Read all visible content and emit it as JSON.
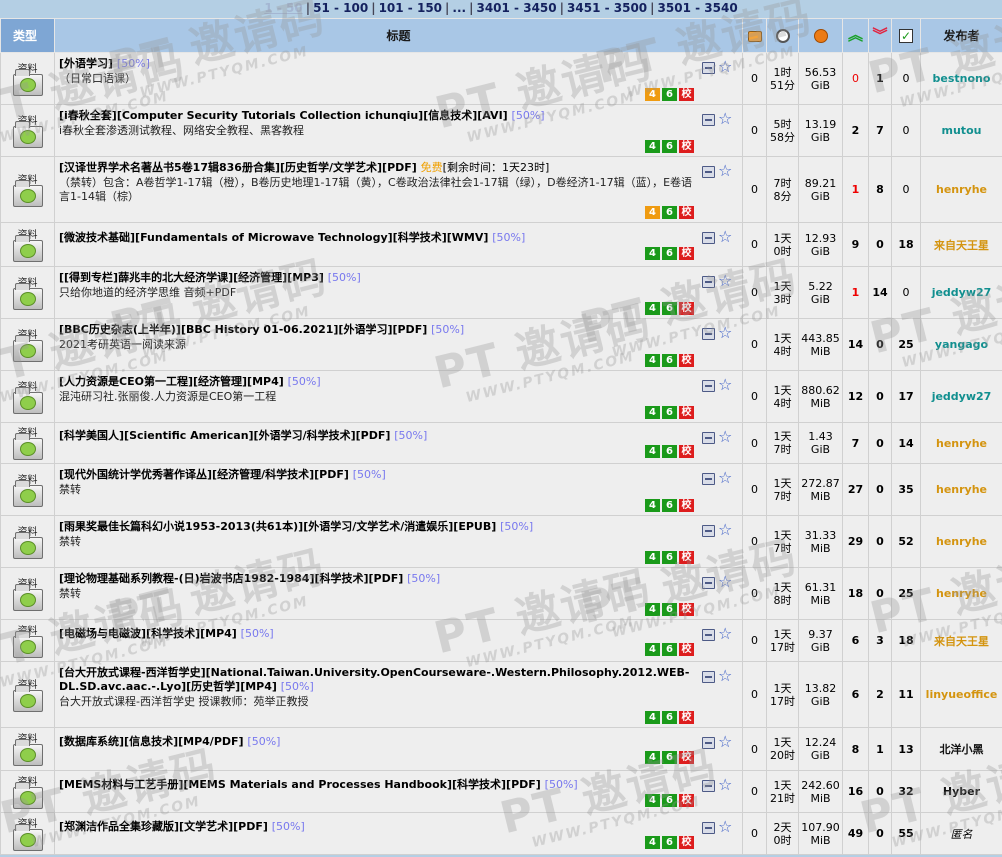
{
  "pager": {
    "items": [
      "1 - 50",
      "51 - 100",
      "101 - 150",
      "...",
      "3401 - 3450",
      "3451 - 3500",
      "3501 - 3540"
    ],
    "current_index": 0,
    "separator": "|"
  },
  "header": {
    "type": "类型",
    "title": "标题",
    "uploader": "发布者",
    "icons": [
      "comments-icon",
      "time-icon",
      "size-icon",
      "seeders-icon",
      "leechers-icon",
      "completed-icon"
    ]
  },
  "watermark": {
    "big": "PT 邀请码",
    "small": "WWW.PTYQM.COM"
  },
  "torrents": [
    {
      "category": "资料",
      "title": "[外语学习]",
      "pct": "[50%]",
      "sub": "（日常口语课）",
      "free": "",
      "remain": "",
      "badge4": "orange",
      "comments": "0",
      "time": [
        "1时",
        "51分"
      ],
      "size": [
        "56.53",
        "GiB"
      ],
      "seeders": "0",
      "leechers": "1",
      "completed": "0",
      "uploader": "bestnono",
      "uploader_color": "teal"
    },
    {
      "category": "资料",
      "title": "[i春秋全套][Computer Security Tutorials Collection ichunqiu][信息技术][AVI]",
      "pct": "[50%]",
      "sub": "i春秋全套渗透测试教程、网络安全教程、黑客教程",
      "free": "",
      "remain": "",
      "badge4": "green",
      "comments": "0",
      "time": [
        "5时",
        "58分"
      ],
      "size": [
        "13.19",
        "GiB"
      ],
      "seeders": "2",
      "leechers": "7",
      "completed": "0",
      "uploader": "mutou",
      "uploader_color": "teal"
    },
    {
      "category": "资料",
      "title": "[汉译世界学术名著丛书5卷17辑836册合集][历史哲学/文学艺术][PDF]",
      "pct": "",
      "sub": "（禁转）包含：A卷哲学1-17辑（橙），B卷历史地理1-17辑（黄），C卷政治法律社会1-17辑（绿），D卷经济1-17辑（蓝），E卷语言1-14辑（棕）",
      "free": "免费",
      "remain": "[剩余时间：1天23时]",
      "badge4": "orange",
      "comments": "0",
      "time": [
        "7时",
        "8分"
      ],
      "size": [
        "89.21",
        "GiB"
      ],
      "seeders": "1",
      "leechers": "8",
      "completed": "0",
      "uploader": "henryhe",
      "uploader_color": "orange"
    },
    {
      "category": "资料",
      "title": "[微波技术基础][Fundamentals of Microwave Technology][科学技术][WMV]",
      "pct": "[50%]",
      "sub": "",
      "free": "",
      "remain": "",
      "badge4": "green",
      "comments": "0",
      "time": [
        "1天",
        "0时"
      ],
      "size": [
        "12.93",
        "GiB"
      ],
      "seeders": "9",
      "leechers": "0",
      "completed": "18",
      "uploader": "来自天王星",
      "uploader_color": "orange"
    },
    {
      "category": "资料",
      "title": "[[得到专栏]薛兆丰的北大经济学课][经济管理][MP3]",
      "pct": "[50%]",
      "sub": "只给你地道的经济学思维 音频+PDF",
      "free": "",
      "remain": "",
      "badge4": "green",
      "comments": "0",
      "time": [
        "1天",
        "3时"
      ],
      "size": [
        "5.22",
        "GiB"
      ],
      "seeders": "1",
      "leechers": "14",
      "completed": "0",
      "uploader": "jeddyw27",
      "uploader_color": "teal"
    },
    {
      "category": "资料",
      "title": "[BBC历史杂志(上半年)][BBC History 01-06.2021][外语学习][PDF]",
      "pct": "[50%]",
      "sub": "2021考研英语一阅读来源",
      "free": "",
      "remain": "",
      "badge4": "green",
      "comments": "0",
      "time": [
        "1天",
        "4时"
      ],
      "size": [
        "443.85",
        "MiB"
      ],
      "seeders": "14",
      "leechers": "0",
      "completed": "25",
      "uploader": "yangago",
      "uploader_color": "teal"
    },
    {
      "category": "资料",
      "title": "[人力资源是CEO第一工程][经济管理][MP4]",
      "pct": "[50%]",
      "sub": "混沌研习社.张丽俊.人力资源是CEO第一工程",
      "free": "",
      "remain": "",
      "badge4": "green",
      "comments": "0",
      "time": [
        "1天",
        "4时"
      ],
      "size": [
        "880.62",
        "MiB"
      ],
      "seeders": "12",
      "leechers": "0",
      "completed": "17",
      "uploader": "jeddyw27",
      "uploader_color": "teal"
    },
    {
      "category": "资料",
      "title": "[科学美国人][Scientific American][外语学习/科学技术][PDF]",
      "pct": "[50%]",
      "sub": "",
      "free": "",
      "remain": "",
      "badge4": "green",
      "comments": "0",
      "time": [
        "1天",
        "7时"
      ],
      "size": [
        "1.43",
        "GiB"
      ],
      "seeders": "7",
      "leechers": "0",
      "completed": "14",
      "uploader": "henryhe",
      "uploader_color": "orange"
    },
    {
      "category": "资料",
      "title": "[现代外国统计学优秀著作译丛][经济管理/科学技术][PDF]",
      "pct": "[50%]",
      "sub": "禁转",
      "free": "",
      "remain": "",
      "badge4": "green",
      "comments": "0",
      "time": [
        "1天",
        "7时"
      ],
      "size": [
        "272.87",
        "MiB"
      ],
      "seeders": "27",
      "leechers": "0",
      "completed": "35",
      "uploader": "henryhe",
      "uploader_color": "orange"
    },
    {
      "category": "资料",
      "title": "[雨果奖最佳长篇科幻小说1953-2013(共61本)][外语学习/文学艺术/消遣娱乐][EPUB]",
      "pct": "[50%]",
      "sub": "禁转",
      "free": "",
      "remain": "",
      "badge4": "green",
      "comments": "0",
      "time": [
        "1天",
        "7时"
      ],
      "size": [
        "31.33",
        "MiB"
      ],
      "seeders": "29",
      "leechers": "0",
      "completed": "52",
      "uploader": "henryhe",
      "uploader_color": "orange"
    },
    {
      "category": "资料",
      "title": "[理论物理基础系列教程-(日)岩波书店1982-1984][科学技术][PDF]",
      "pct": "[50%]",
      "sub": "禁转",
      "free": "",
      "remain": "",
      "badge4": "green",
      "comments": "0",
      "time": [
        "1天",
        "8时"
      ],
      "size": [
        "61.31",
        "MiB"
      ],
      "seeders": "18",
      "leechers": "0",
      "completed": "25",
      "uploader": "henryhe",
      "uploader_color": "orange"
    },
    {
      "category": "资料",
      "title": "[电磁场与电磁波][科学技术][MP4]",
      "pct": "[50%]",
      "sub": "",
      "free": "",
      "remain": "",
      "badge4": "green",
      "comments": "0",
      "time": [
        "1天",
        "17时"
      ],
      "size": [
        "9.37",
        "GiB"
      ],
      "seeders": "6",
      "leechers": "3",
      "completed": "18",
      "uploader": "来自天王星",
      "uploader_color": "orange"
    },
    {
      "category": "资料",
      "title": "[台大开放式课程-西洋哲学史][National.Taiwan.University.OpenCourseware-.Western.Philosophy.2012.WEB-DL.SD.avc.aac.-.Lyo][历史哲学][MP4]",
      "pct": "[50%]",
      "sub": "台大开放式课程-西洋哲学史 授课教师：苑举正教授",
      "free": "",
      "remain": "",
      "badge4": "green",
      "comments": "0",
      "time": [
        "1天",
        "17时"
      ],
      "size": [
        "13.82",
        "GiB"
      ],
      "seeders": "6",
      "leechers": "2",
      "completed": "11",
      "uploader": "linyueoffice",
      "uploader_color": "orange"
    },
    {
      "category": "资料",
      "title": "[数据库系统][信息技术][MP4/PDF]",
      "pct": "[50%]",
      "sub": "",
      "free": "",
      "remain": "",
      "badge4": "green",
      "comments": "0",
      "time": [
        "1天",
        "20时"
      ],
      "size": [
        "12.24",
        "GiB"
      ],
      "seeders": "8",
      "leechers": "1",
      "completed": "13",
      "uploader": "北洋小黑",
      "uploader_color": "black"
    },
    {
      "category": "资料",
      "title": "[MEMS材料与工艺手册][MEMS Materials and Processes Handbook][科学技术][PDF]",
      "pct": "[50%]",
      "sub": "",
      "free": "",
      "remain": "",
      "badge4": "green",
      "comments": "0",
      "time": [
        "1天",
        "21时"
      ],
      "size": [
        "242.60",
        "MiB"
      ],
      "seeders": "16",
      "leechers": "0",
      "completed": "32",
      "uploader": "Hyber",
      "uploader_color": "black"
    },
    {
      "category": "资料",
      "title": "[郑渊洁作品全集珍藏版][文学艺术][PDF]",
      "pct": "[50%]",
      "sub": "",
      "free": "",
      "remain": "",
      "badge4": "green",
      "comments": "0",
      "time": [
        "2天",
        "0时"
      ],
      "size": [
        "107.90",
        "MiB"
      ],
      "seeders": "49",
      "leechers": "0",
      "completed": "55",
      "uploader": "匿名",
      "uploader_color": "anon"
    }
  ],
  "badge_labels": {
    "quality": "4",
    "codec": "6",
    "verified": "校"
  }
}
